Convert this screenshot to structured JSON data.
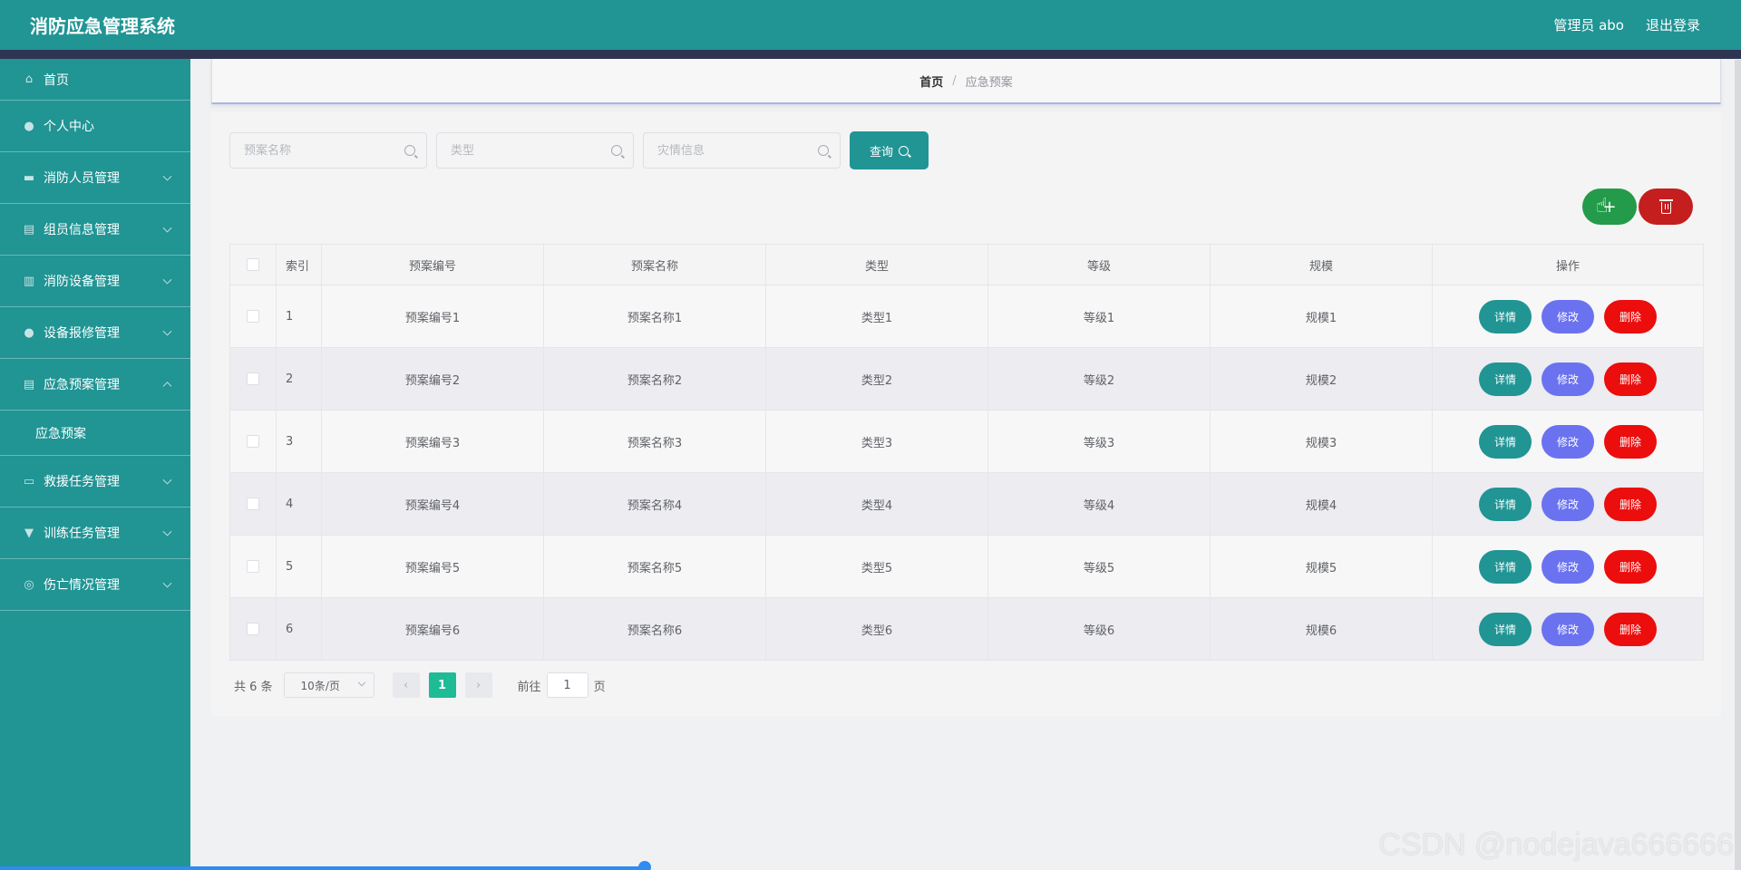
{
  "header": {
    "app_title": "消防应急管理系统",
    "user_label": "管理员 abo",
    "logout_label": "退出登录"
  },
  "sidebar": {
    "items": [
      {
        "label": "首页",
        "icon": "home-icon"
      },
      {
        "label": "个人中心",
        "icon": "user-icon"
      },
      {
        "label": "消防人员管理",
        "icon": "briefcase-icon"
      },
      {
        "label": "组员信息管理",
        "icon": "clipboard-icon"
      },
      {
        "label": "消防设备管理",
        "icon": "chart-icon"
      },
      {
        "label": "设备报修管理",
        "icon": "user-icon"
      },
      {
        "label": "应急预案管理",
        "icon": "clipboard-icon"
      },
      {
        "label": "应急预案",
        "icon": ""
      },
      {
        "label": "救援任务管理",
        "icon": "card-icon"
      },
      {
        "label": "训练任务管理",
        "icon": "trophy-icon"
      },
      {
        "label": "伤亡情况管理",
        "icon": "compass-icon"
      }
    ]
  },
  "breadcrumb": {
    "home": "首页",
    "separator": "/",
    "current": "应急预案"
  },
  "search": {
    "plan_name_placeholder": "预案名称",
    "type_placeholder": "类型",
    "disaster_placeholder": "灾情信息",
    "query_label": "查询"
  },
  "table": {
    "headers": [
      "索引",
      "预案编号",
      "预案名称",
      "类型",
      "等级",
      "规模",
      "操作"
    ],
    "rows": [
      {
        "index": "1",
        "code": "预案编号1",
        "name": "预案名称1",
        "type": "类型1",
        "level": "等级1",
        "scale": "规模1"
      },
      {
        "index": "2",
        "code": "预案编号2",
        "name": "预案名称2",
        "type": "类型2",
        "level": "等级2",
        "scale": "规模2"
      },
      {
        "index": "3",
        "code": "预案编号3",
        "name": "预案名称3",
        "type": "类型3",
        "level": "等级3",
        "scale": "规模3"
      },
      {
        "index": "4",
        "code": "预案编号4",
        "name": "预案名称4",
        "type": "类型4",
        "level": "等级4",
        "scale": "规模4"
      },
      {
        "index": "5",
        "code": "预案编号5",
        "name": "预案名称5",
        "type": "类型5",
        "level": "等级5",
        "scale": "规模5"
      },
      {
        "index": "6",
        "code": "预案编号6",
        "name": "预案名称6",
        "type": "类型6",
        "level": "等级6",
        "scale": "规模6"
      }
    ],
    "actions": {
      "detail": "详情",
      "edit": "修改",
      "delete": "删除"
    }
  },
  "pagination": {
    "total": "共 6 条",
    "page_size": "10条/页",
    "current_page": "1",
    "goto_label": "前往",
    "goto_value": "1",
    "goto_unit": "页"
  },
  "watermark": "CSDN @nodejava666666",
  "colors": {
    "primary": "#219494",
    "header_strip": "#2e3552",
    "add": "#249b4a",
    "batch_delete": "#c51e1e",
    "edit": "#6b72f0",
    "delete": "#ec0d0d",
    "page_active": "#1dbb96"
  }
}
